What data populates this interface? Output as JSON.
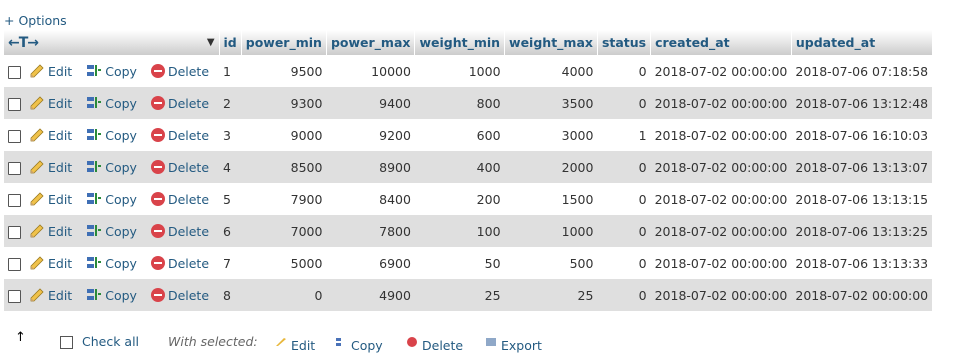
{
  "options_label": "+ Options",
  "header": {
    "arrows": "←T→",
    "columns": [
      "id",
      "power_min",
      "power_max",
      "weight_min",
      "weight_max",
      "status",
      "created_at",
      "updated_at"
    ]
  },
  "actions": {
    "edit": "Edit",
    "copy": "Copy",
    "delete": "Delete"
  },
  "rows": [
    {
      "id": "1",
      "power_min": "9500",
      "power_max": "10000",
      "weight_min": "1000",
      "weight_max": "4000",
      "status": "0",
      "created_at": "2018-07-02 00:00:00",
      "updated_at": "2018-07-06 07:18:58"
    },
    {
      "id": "2",
      "power_min": "9300",
      "power_max": "9400",
      "weight_min": "800",
      "weight_max": "3500",
      "status": "0",
      "created_at": "2018-07-02 00:00:00",
      "updated_at": "2018-07-06 13:12:48"
    },
    {
      "id": "3",
      "power_min": "9000",
      "power_max": "9200",
      "weight_min": "600",
      "weight_max": "3000",
      "status": "1",
      "created_at": "2018-07-02 00:00:00",
      "updated_at": "2018-07-06 16:10:03"
    },
    {
      "id": "4",
      "power_min": "8500",
      "power_max": "8900",
      "weight_min": "400",
      "weight_max": "2000",
      "status": "0",
      "created_at": "2018-07-02 00:00:00",
      "updated_at": "2018-07-06 13:13:07"
    },
    {
      "id": "5",
      "power_min": "7900",
      "power_max": "8400",
      "weight_min": "200",
      "weight_max": "1500",
      "status": "0",
      "created_at": "2018-07-02 00:00:00",
      "updated_at": "2018-07-06 13:13:15"
    },
    {
      "id": "6",
      "power_min": "7000",
      "power_max": "7800",
      "weight_min": "100",
      "weight_max": "1000",
      "status": "0",
      "created_at": "2018-07-02 00:00:00",
      "updated_at": "2018-07-06 13:13:25"
    },
    {
      "id": "7",
      "power_min": "5000",
      "power_max": "6900",
      "weight_min": "50",
      "weight_max": "500",
      "status": "0",
      "created_at": "2018-07-02 00:00:00",
      "updated_at": "2018-07-06 13:13:33"
    },
    {
      "id": "8",
      "power_min": "0",
      "power_max": "4900",
      "weight_min": "25",
      "weight_max": "25",
      "status": "0",
      "created_at": "2018-07-02 00:00:00",
      "updated_at": "2018-07-02 00:00:00"
    }
  ],
  "footer": {
    "check_all": "Check all",
    "with_selected": "With selected:",
    "edit": "Edit",
    "copy": "Copy",
    "delete": "Delete",
    "export": "Export"
  }
}
